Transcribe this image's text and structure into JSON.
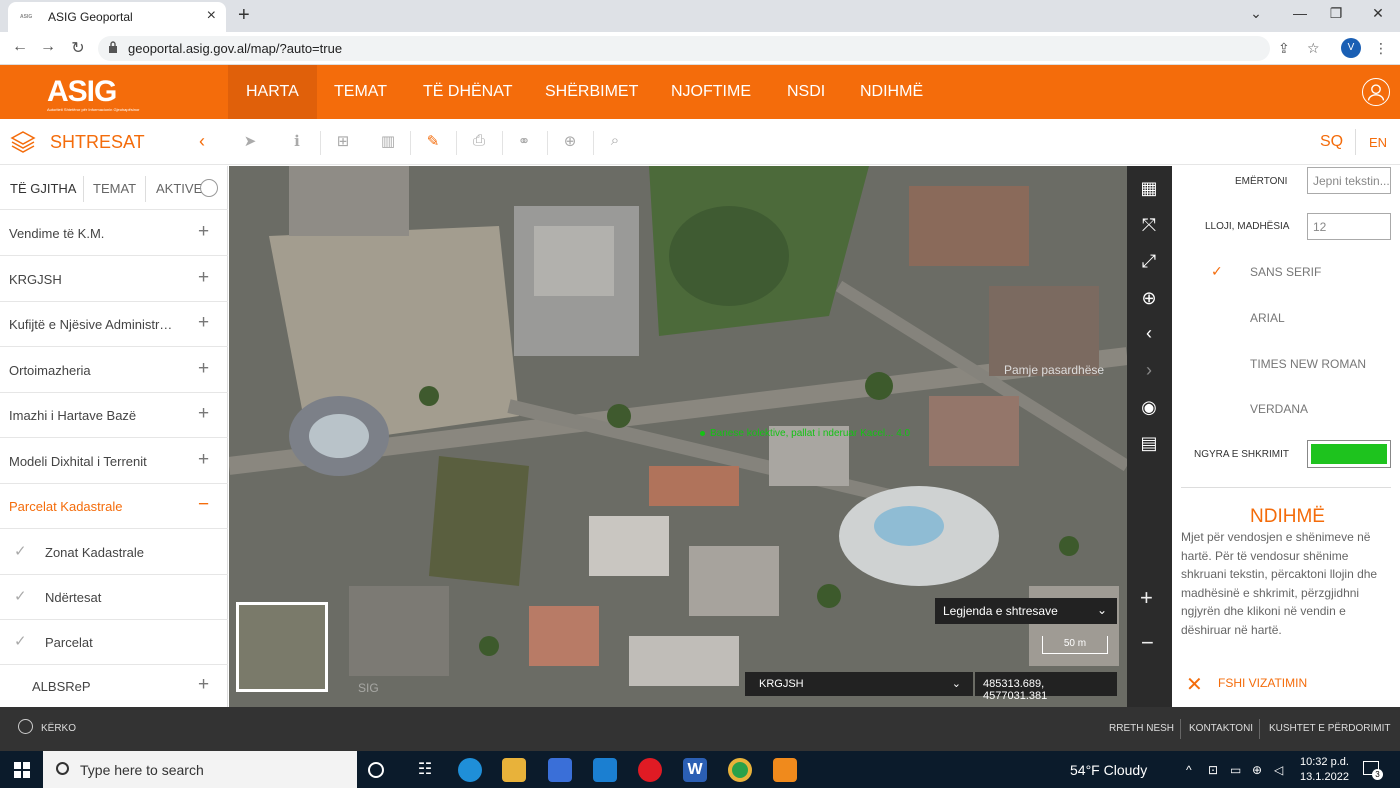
{
  "browser": {
    "tab_title": "ASIG Geoportal",
    "favicon_text": "ASIG",
    "url": "geoportal.asig.gov.al/map/?auto=true",
    "profile_initial": "V"
  },
  "header": {
    "logo": "ASIG",
    "logo_subtitle": "Autoriteti Shtetëror për Informacionin Gjeohapësinor",
    "menu": [
      "HARTA",
      "TEMAT",
      "TË DHËNAT",
      "SHËRBIMET",
      "NJOFTIME",
      "NSDI",
      "NDIHMË"
    ],
    "active_menu": "HARTA"
  },
  "toolbar": {
    "panel_title": "SHTRESAT",
    "lang_sq": "SQ",
    "lang_en": "EN"
  },
  "sidebar": {
    "tabs": [
      "TË GJITHA",
      "TEMAT",
      "AKTIVE"
    ],
    "items": [
      {
        "label": "Vendime të K.M.",
        "toggle": "+"
      },
      {
        "label": "KRGJSH",
        "toggle": "+"
      },
      {
        "label": "Kufijtë e Njësive Administrative",
        "toggle": "+"
      },
      {
        "label": "Ortoimazheria",
        "toggle": "+"
      },
      {
        "label": "Imazhi i Hartave Bazë",
        "toggle": "+"
      },
      {
        "label": "Modeli Dixhital i Terrenit",
        "toggle": "+"
      },
      {
        "label": "Parcelat Kadastrale",
        "toggle": "−"
      }
    ],
    "subitems": [
      "Zonat Kadastrale",
      "Ndërtesat",
      "Parcelat"
    ],
    "last_item": {
      "label": "ALBSReP",
      "toggle": "+"
    }
  },
  "map": {
    "previous_view": "Pamje pasardhëse",
    "feature_label": "Banese kolektive, pallat i nderuar Kacel... 4.0",
    "legend_label": "Legjenda e shtresave",
    "scale": "50 m",
    "crs": "KRGJSH",
    "coordinates": "485313.689, 4577031.381",
    "watermark": "SIG"
  },
  "right_panel": {
    "name_label": "EMËRTONI",
    "name_placeholder": "Jepni tekstin...",
    "size_label": "LLOJI, MADHËSIA",
    "size_value": "12",
    "fonts": [
      "SANS SERIF",
      "ARIAL",
      "TIMES NEW ROMAN",
      "VERDANA"
    ],
    "selected_font": "SANS SERIF",
    "color_label": "NGYRA E SHKRIMIT",
    "text_color": "#1ec31e",
    "help_title": "NDIHMË",
    "help_text": "Mjet për vendosjen e shënimeve në hartë. Për të vendosur shënime shkruani tekstin, përcaktoni llojin dhe madhësinë e shkrimit, përzgjidhni ngjyrën dhe klikoni në vendin e dëshiruar në hartë.",
    "clear_label": "FSHI VIZATIMIN"
  },
  "footer": {
    "search_label": "KËRKO",
    "links": [
      "RRETH NESH",
      "KONTAKTONI",
      "KUSHTET E PËRDORIMIT"
    ]
  },
  "taskbar": {
    "search_placeholder": "Type here to search",
    "weather": "54°F  Cloudy",
    "time": "10:32 p.d.",
    "date": "13.1.2022",
    "notifications": "3"
  },
  "colors": {
    "brand": "#f46c0b",
    "map_bg": "#6d6e66"
  }
}
